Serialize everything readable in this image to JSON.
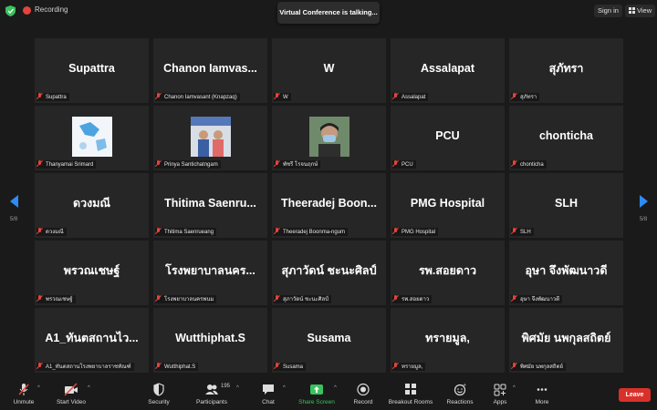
{
  "topbar": {
    "recording_label": "Recording",
    "toast": "Virtual Conference is talking...",
    "sign_in": "Sign in",
    "view": "View"
  },
  "nav": {
    "left_page": "5/8",
    "right_page": "5/8"
  },
  "colors": {
    "accent": "#2e8cf5",
    "leave": "#d9312a",
    "muted": "#e5443b",
    "share": "#3ac25f"
  },
  "tiles": [
    {
      "big": "Supattra",
      "label": "Supattra"
    },
    {
      "big": "Chanon  Iamvas...",
      "label": "Chanon Iamvasant (Knapzaq)"
    },
    {
      "big": "W",
      "label": "W"
    },
    {
      "big": "Assalapat",
      "label": "Assalapat"
    },
    {
      "big": "สุภัทรา",
      "label": "สุภัทรา"
    },
    {
      "big": "",
      "label": "Thanyamai Srimard",
      "thumb": "map-thumbnail"
    },
    {
      "big": "",
      "label": "Prinya Santichatngam",
      "thumb": "people-thumbnail"
    },
    {
      "big": "",
      "label": "พัชรี โรจนฤกษ์",
      "thumb": "face-thumbnail"
    },
    {
      "big": "PCU",
      "label": "PCU"
    },
    {
      "big": "chonticha",
      "label": "chonticha"
    },
    {
      "big": "ดวงมณี",
      "label": "ดวงมณี"
    },
    {
      "big": "Thitima  Saenru...",
      "label": "Thitima Saenrueang"
    },
    {
      "big": "Theeradej  Boon...",
      "label": "Theeradej Boonma-ngum"
    },
    {
      "big": "PMG Hospital",
      "label": "PMG Hospital"
    },
    {
      "big": "SLH",
      "label": "SLH"
    },
    {
      "big": "พรวณเชษฐ์",
      "label": "พรวณเชษฐ์"
    },
    {
      "big": "โรงพยาบาลนคร...",
      "label": "โรงพยาบาลนครพนม"
    },
    {
      "big": "สุภาวัดน์ ชะนะศิลป์",
      "label": "สุภาวัดน์ ชะนะศิลป์"
    },
    {
      "big": "รพ.สอยดาว",
      "label": "รพ.สอยดาว"
    },
    {
      "big": "อุษา จึงพัฒนาวดี",
      "label": "อุษา จึงพัฒนาวดี"
    },
    {
      "big": "A1_ทันตสถานไว...",
      "label": "A1_ทันตสถานโรงพยาบาลราชทัณฑ์"
    },
    {
      "big": "Wutthiphat.S",
      "label": "Wutthiphat.S"
    },
    {
      "big": "Susama",
      "label": "Susama"
    },
    {
      "big": "ทรายมูล,",
      "label": "ทรายมูล,"
    },
    {
      "big": "พิศมัย นพกุลสถิตย์",
      "label": "พิศมัย นพกุลสถิตย์"
    }
  ],
  "toolbar": {
    "unmute": "Unmute",
    "start_video": "Start Video",
    "security": "Security",
    "participants": "Participants",
    "participants_count": "195",
    "chat": "Chat",
    "share_screen": "Share Screen",
    "record": "Record",
    "breakout_rooms": "Breakout Rooms",
    "reactions": "Reactions",
    "apps": "Apps",
    "more": "More",
    "leave": "Leave"
  }
}
